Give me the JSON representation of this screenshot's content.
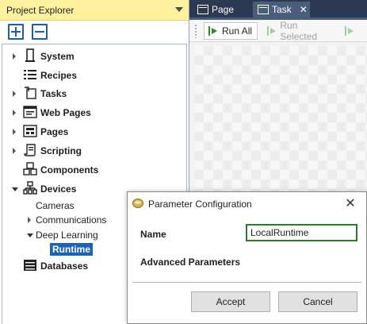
{
  "explorer": {
    "title": "Project Explorer",
    "tree": [
      {
        "label": "System",
        "icon": "device-icon",
        "expander": "collapsed"
      },
      {
        "label": "Recipes",
        "icon": "list-icon",
        "expander": "none"
      },
      {
        "label": "Tasks",
        "icon": "task-icon",
        "expander": "collapsed"
      },
      {
        "label": "Web Pages",
        "icon": "web-page-icon",
        "expander": "collapsed"
      },
      {
        "label": "Pages",
        "icon": "page-icon",
        "expander": "collapsed"
      },
      {
        "label": "Scripting",
        "icon": "script-icon",
        "expander": "collapsed"
      },
      {
        "label": "Components",
        "icon": "components-icon",
        "expander": "none"
      },
      {
        "label": "Devices",
        "icon": "network-icon",
        "expander": "expanded"
      },
      {
        "label": "Cameras",
        "expander": "none"
      },
      {
        "label": "Communications",
        "expander": "collapsed"
      },
      {
        "label": "Deep Learning",
        "expander": "expanded"
      },
      {
        "label": "Runtime",
        "expander": "none"
      },
      {
        "label": "Databases",
        "icon": "database-icon",
        "expander": "none"
      }
    ]
  },
  "tabs": [
    {
      "label": "Page",
      "active": false
    },
    {
      "label": "Task",
      "active": true,
      "close": "✕"
    }
  ],
  "toolbar": {
    "run_all": "Run All",
    "run_selected": "Run Selected"
  },
  "dialog": {
    "title": "Parameter Configuration",
    "close": "✕",
    "name_label": "Name",
    "name_value": "LocalRuntime",
    "advanced_label": "Advanced Parameters",
    "accept": "Accept",
    "cancel": "Cancel"
  },
  "colors": {
    "explorer_header": "#fff19d",
    "tab_bar": "#2b3a52",
    "selection": "#1c63b7",
    "input_focus": "#2d7a2d"
  }
}
